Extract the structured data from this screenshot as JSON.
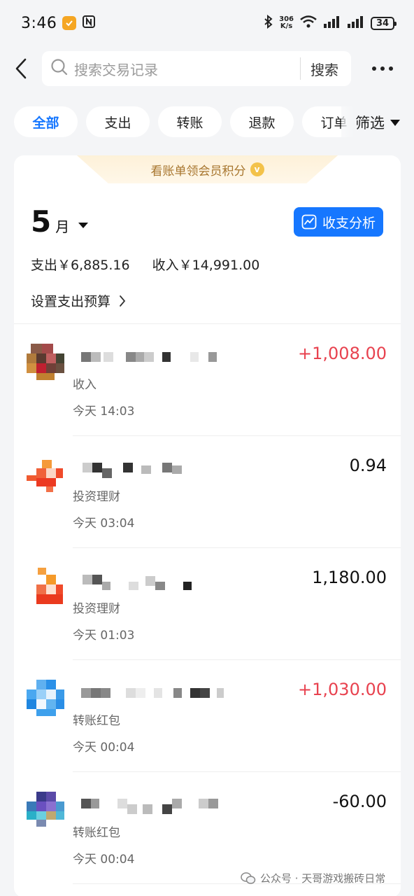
{
  "status_bar": {
    "time": "3:46",
    "net_speed_value": "306",
    "net_speed_unit": "K/s",
    "battery": "34"
  },
  "top_bar": {
    "search_placeholder": "搜索交易记录",
    "search_button": "搜索"
  },
  "filters": {
    "chips": [
      "全部",
      "支出",
      "转账",
      "退款",
      "订单"
    ],
    "active": "全部",
    "menu_label": "筛选"
  },
  "summary": {
    "banner": "看账单领会员积分",
    "month_number": "5",
    "month_unit": "月",
    "analysis_button": "收支分析",
    "expense": "支出￥6,885.16",
    "income": "收入￥14,991.00",
    "budget_link": "设置支出预算"
  },
  "transactions": [
    {
      "category": "收入",
      "time": "今天 14:03",
      "amount": "+1,008.00",
      "type": "income"
    },
    {
      "category": "投资理财",
      "time": "今天 03:04",
      "amount": "0.94",
      "type": "neutral"
    },
    {
      "category": "投资理财",
      "time": "今天 01:03",
      "amount": "1,180.00",
      "type": "neutral"
    },
    {
      "category": "转账红包",
      "time": "今天 00:04",
      "amount": "+1,030.00",
      "type": "income"
    },
    {
      "category": "转账红包",
      "time": "今天 00:04",
      "amount": "-60.00",
      "type": "expense"
    }
  ],
  "watermark": "公众号 · 天哥游戏搬砖日常",
  "colors": {
    "accent": "#1677ff",
    "income": "#e8424f",
    "background": "#f4f5f7"
  }
}
